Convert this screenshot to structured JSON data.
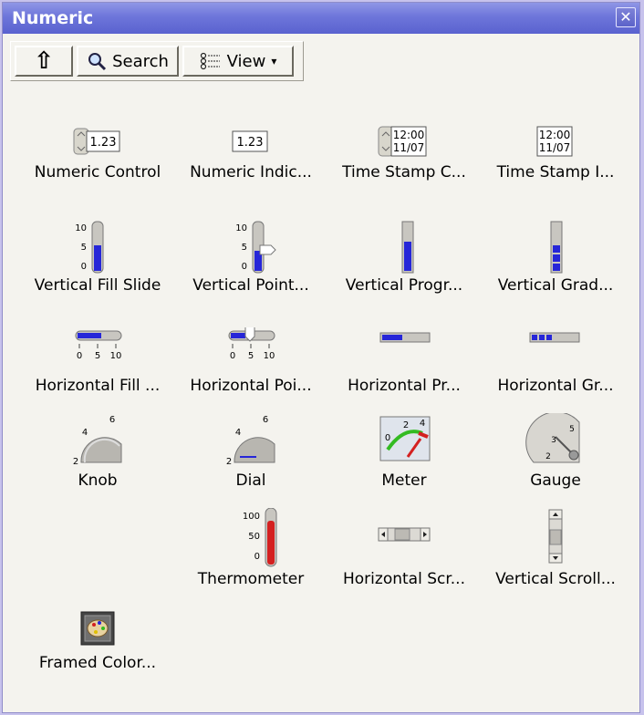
{
  "window": {
    "title": "Numeric",
    "close_glyph": "✕"
  },
  "toolbar": {
    "up_glyph": "⇧",
    "search_label": "Search",
    "view_label": "View",
    "view_arrow": "▾"
  },
  "items": [
    {
      "label": "Numeric Control",
      "icon": "numeric-control-icon",
      "display": "1.23"
    },
    {
      "label": "Numeric Indic...",
      "icon": "numeric-indicator-icon",
      "display": "1.23"
    },
    {
      "label": "Time Stamp C...",
      "icon": "time-stamp-control-icon",
      "time": "12:00",
      "date": "11/07"
    },
    {
      "label": "Time Stamp I...",
      "icon": "time-stamp-indicator-icon",
      "time": "12:00",
      "date": "11/07"
    },
    {
      "label": "Vertical Fill Slide",
      "icon": "vertical-fill-slide-icon",
      "scale": [
        "10",
        "5",
        "0"
      ]
    },
    {
      "label": "Vertical Point...",
      "icon": "vertical-pointer-slide-icon",
      "scale": [
        "10",
        "5",
        "0"
      ]
    },
    {
      "label": "Vertical Progr...",
      "icon": "vertical-progress-bar-icon"
    },
    {
      "label": "Vertical Grad...",
      "icon": "vertical-graduated-bar-icon"
    },
    {
      "label": "Horizontal Fill ...",
      "icon": "horizontal-fill-slide-icon",
      "scale": [
        "0",
        "5",
        "10"
      ]
    },
    {
      "label": "Horizontal Poi...",
      "icon": "horizontal-pointer-slide-icon",
      "scale": [
        "0",
        "5",
        "10"
      ]
    },
    {
      "label": "Horizontal Pr...",
      "icon": "horizontal-progress-bar-icon"
    },
    {
      "label": "Horizontal Gr...",
      "icon": "horizontal-graduated-bar-icon"
    },
    {
      "label": "Knob",
      "icon": "knob-icon",
      "scale": [
        "2",
        "4",
        "6"
      ]
    },
    {
      "label": "Dial",
      "icon": "dial-icon",
      "scale": [
        "2",
        "4",
        "6"
      ]
    },
    {
      "label": "Meter",
      "icon": "meter-icon",
      "scale": [
        "0",
        "2",
        "4"
      ]
    },
    {
      "label": "Gauge",
      "icon": "gauge-icon",
      "scale": [
        "2",
        "3",
        "5"
      ]
    },
    {
      "label": "Thermometer",
      "icon": "thermometer-icon",
      "scale": [
        "100",
        "50",
        "0"
      ]
    },
    {
      "label": "Horizontal Scr...",
      "icon": "horizontal-scrollbar-icon"
    },
    {
      "label": "Vertical Scroll...",
      "icon": "vertical-scrollbar-icon"
    },
    {
      "label": "Framed Color...",
      "icon": "framed-color-box-icon"
    }
  ],
  "colors": {
    "title_bar": "#6d75da",
    "panel_background": "#f4f3ee",
    "fill_blue": "#2626d8",
    "thermometer_red": "#d42020"
  }
}
